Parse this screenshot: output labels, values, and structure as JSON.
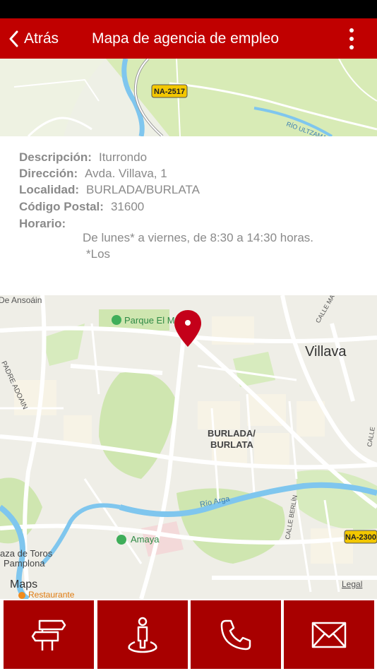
{
  "navbar": {
    "back_label": "Atrás",
    "title": "Mapa de agencia de empleo",
    "more_icon": "more-vertical-icon"
  },
  "map_top": {
    "road_badge": "NA-2517",
    "river_label": "RÍO ULTZAMA"
  },
  "info": {
    "descripcion_label": "Descripción:",
    "descripcion_value": "Iturrondo",
    "direccion_label": "Dirección:",
    "direccion_value": "Avda. Villava, 1",
    "localidad_label": "Localidad:",
    "localidad_value": "BURLADA/BURLATA",
    "codigo_label": "Código Postal:",
    "codigo_value": "31600",
    "horario_label": "Horario:",
    "horario_line1": "De lunes* a viernes, de 8:30 a 14:30 horas.",
    "horario_line2": "*Los"
  },
  "map_main": {
    "label_ansoain": "De Ansoáin",
    "label_parque": "Parque El M",
    "label_villava": "Villava",
    "label_burlada1": "BURLADA/",
    "label_burlada2": "BURLATA",
    "label_padre": "PADRE ADOAIN",
    "label_rio_arga": "Río Arga",
    "label_amaya": "Amaya",
    "label_plaza1": "aza de Toros",
    "label_plaza2": "Pamplona",
    "label_calle_berlin": "CALLE BERLÍN",
    "label_calle_ma": "CALLE MA",
    "label_calle_right": "CALLE",
    "road_badge": "NA-2300",
    "maps_logo": "Maps",
    "legal": "Legal",
    "restaurante": "Restaurante"
  },
  "bottom_tabs": [
    {
      "name": "directions",
      "icon": "signpost-icon"
    },
    {
      "name": "street-view",
      "icon": "person-pin-icon"
    },
    {
      "name": "call",
      "icon": "phone-icon"
    },
    {
      "name": "email",
      "icon": "envelope-icon"
    }
  ],
  "colors": {
    "navbar": "#c00000",
    "tabbar": "#a80000",
    "pin": "#c4001a",
    "park_green": "#c9e6a8",
    "water": "#7fc6ee"
  }
}
